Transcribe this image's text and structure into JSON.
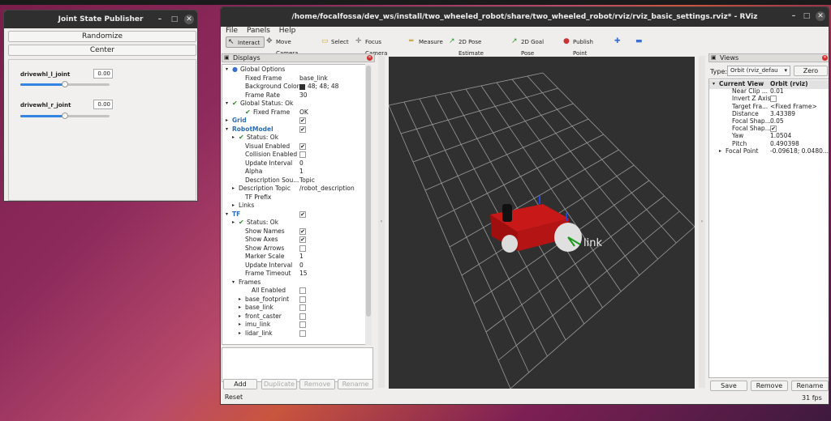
{
  "jsp": {
    "title": "Joint State Publisher",
    "randomize": "Randomize",
    "center": "Center",
    "joints": [
      {
        "name": "drivewhl_l_joint",
        "value": "0.00",
        "slider_fraction": 0.5
      },
      {
        "name": "drivewhl_r_joint",
        "value": "0.00",
        "slider_fraction": 0.5
      }
    ]
  },
  "rviz": {
    "title": "/home/focalfossa/dev_ws/install/two_wheeled_robot/share/two_wheeled_robot/rviz/rviz_basic_settings.rviz* - RViz",
    "menu": [
      "File",
      "Panels",
      "Help"
    ],
    "tools": [
      "Interact",
      "Move Camera",
      "Select",
      "Focus Camera",
      "Measure",
      "2D Pose Estimate",
      "2D Goal Pose",
      "Publish Point"
    ],
    "displays": {
      "title": "Displays",
      "rows": [
        {
          "k": "Global Options",
          "v": "",
          "cls": "",
          "indent": 0,
          "arrow": "▾",
          "icon": "globe"
        },
        {
          "k": "Fixed Frame",
          "v": "base_link",
          "cls": "",
          "indent": 2
        },
        {
          "k": "Background Color",
          "v": "48; 48; 48",
          "cls": "",
          "indent": 2,
          "swatch": true
        },
        {
          "k": "Frame Rate",
          "v": "30",
          "cls": "",
          "indent": 2
        },
        {
          "k": "Global Status: Ok",
          "v": "",
          "cls": "",
          "indent": 0,
          "arrow": "▾",
          "check": true
        },
        {
          "k": "Fixed Frame",
          "v": "OK",
          "cls": "",
          "indent": 2,
          "check": true
        },
        {
          "k": "Grid",
          "v": "",
          "cls": "blue",
          "indent": 0,
          "arrow": "▸",
          "box": "✔"
        },
        {
          "k": "RobotModel",
          "v": "",
          "cls": "blue",
          "indent": 0,
          "arrow": "▾",
          "box": "✔"
        },
        {
          "k": "Status: Ok",
          "v": "",
          "cls": "",
          "indent": 1,
          "arrow": "▸",
          "check": true
        },
        {
          "k": "Visual Enabled",
          "v": "",
          "cls": "",
          "indent": 2,
          "box": "✔"
        },
        {
          "k": "Collision Enabled",
          "v": "",
          "cls": "",
          "indent": 2,
          "box": ""
        },
        {
          "k": "Update Interval",
          "v": "0",
          "cls": "",
          "indent": 2
        },
        {
          "k": "Alpha",
          "v": "1",
          "cls": "",
          "indent": 2
        },
        {
          "k": "Description Sou...",
          "v": "Topic",
          "cls": "",
          "indent": 2
        },
        {
          "k": "Description Topic",
          "v": "/robot_description",
          "cls": "",
          "indent": 1,
          "arrow": "▸"
        },
        {
          "k": "TF Prefix",
          "v": "",
          "cls": "",
          "indent": 2
        },
        {
          "k": "Links",
          "v": "",
          "cls": "",
          "indent": 1,
          "arrow": "▸"
        },
        {
          "k": "TF",
          "v": "",
          "cls": "blue",
          "indent": 0,
          "arrow": "▾",
          "box": "✔"
        },
        {
          "k": "Status: Ok",
          "v": "",
          "cls": "",
          "indent": 1,
          "arrow": "▸",
          "check": true
        },
        {
          "k": "Show Names",
          "v": "",
          "cls": "",
          "indent": 2,
          "box": "✔"
        },
        {
          "k": "Show Axes",
          "v": "",
          "cls": "",
          "indent": 2,
          "box": "✔"
        },
        {
          "k": "Show Arrows",
          "v": "",
          "cls": "",
          "indent": 2,
          "box": ""
        },
        {
          "k": "Marker Scale",
          "v": "1",
          "cls": "",
          "indent": 2
        },
        {
          "k": "Update Interval",
          "v": "0",
          "cls": "",
          "indent": 2
        },
        {
          "k": "Frame Timeout",
          "v": "15",
          "cls": "",
          "indent": 2
        },
        {
          "k": "Frames",
          "v": "",
          "cls": "",
          "indent": 1,
          "arrow": "▾"
        },
        {
          "k": "All Enabled",
          "v": "",
          "cls": "",
          "indent": 3,
          "box": ""
        },
        {
          "k": "base_footprint",
          "v": "",
          "cls": "",
          "indent": 2,
          "arrow": "▸",
          "box": ""
        },
        {
          "k": "base_link",
          "v": "",
          "cls": "",
          "indent": 2,
          "arrow": "▸",
          "box": ""
        },
        {
          "k": "front_caster",
          "v": "",
          "cls": "",
          "indent": 2,
          "arrow": "▸",
          "box": ""
        },
        {
          "k": "imu_link",
          "v": "",
          "cls": "",
          "indent": 2,
          "arrow": "▸",
          "box": ""
        },
        {
          "k": "lidar_link",
          "v": "",
          "cls": "",
          "indent": 2,
          "arrow": "▸",
          "box": ""
        }
      ],
      "buttons": [
        "Add",
        "Duplicate",
        "Remove",
        "Rename"
      ],
      "reset": "Reset"
    },
    "views": {
      "title": "Views",
      "type_label": "Type:",
      "type_value": "Orbit (rviz_defau",
      "zero": "Zero",
      "rows": [
        {
          "k": "Current View",
          "v": "Orbit (rviz)",
          "cls": "head",
          "indent": 0,
          "arrow": "▾"
        },
        {
          "k": "Near Clip ...",
          "v": "0.01",
          "indent": 2
        },
        {
          "k": "Invert Z Axis",
          "v": "",
          "indent": 2,
          "box": ""
        },
        {
          "k": "Target Fra...",
          "v": "<Fixed Frame>",
          "indent": 2
        },
        {
          "k": "Distance",
          "v": "3.43389",
          "indent": 2
        },
        {
          "k": "Focal Shap...",
          "v": "0.05",
          "indent": 2
        },
        {
          "k": "Focal Shap...",
          "v": "",
          "indent": 2,
          "box": "✔"
        },
        {
          "k": "Yaw",
          "v": "1.0504",
          "indent": 2
        },
        {
          "k": "Pitch",
          "v": "0.490398",
          "indent": 2
        },
        {
          "k": "Focal Point",
          "v": "-0.09618; 0.0480...",
          "indent": 1,
          "arrow": "▸"
        }
      ],
      "buttons": [
        "Save",
        "Remove",
        "Rename"
      ]
    },
    "scene": {
      "frame_label": "link"
    },
    "fps": "31 fps"
  }
}
